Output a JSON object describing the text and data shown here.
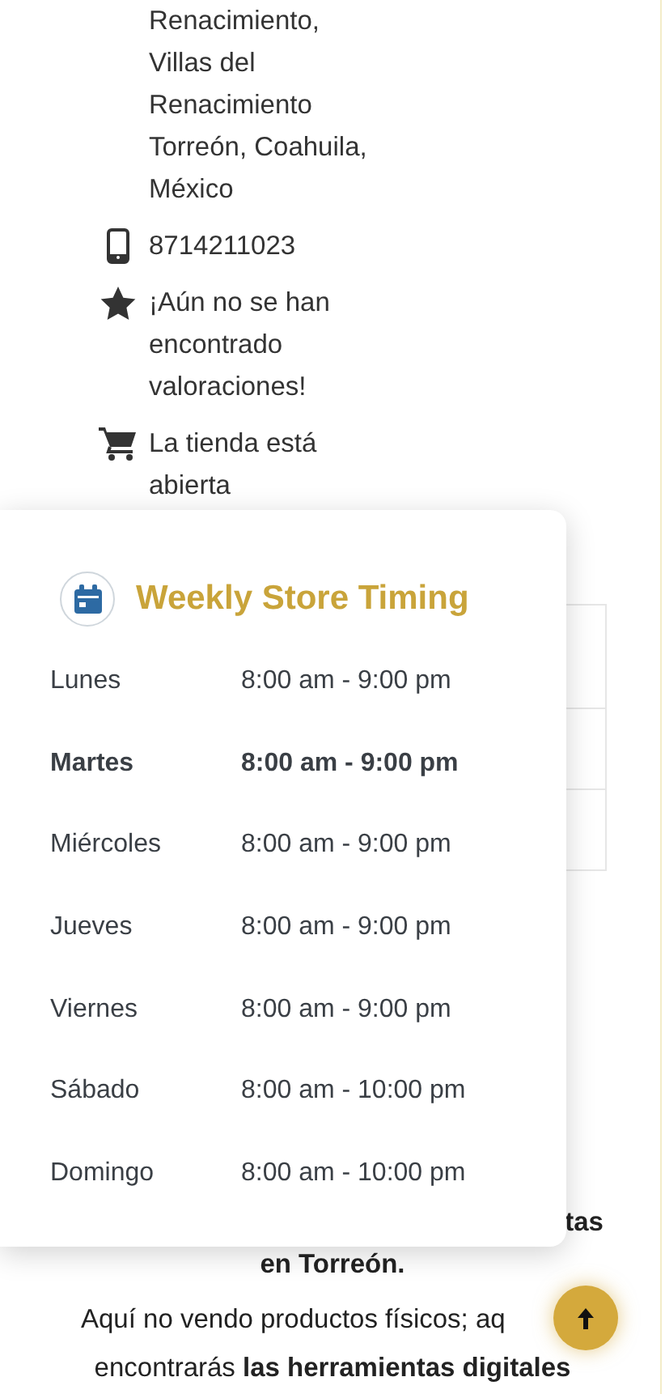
{
  "contact": {
    "address_lines": [
      "Renacimiento,",
      "Villas del",
      "Renacimiento",
      "Torreón, Coahuila,",
      "México"
    ],
    "phone": "8714211023",
    "rating": "¡Aún no se han encontrado valoraciones!",
    "store_status": "La tienda está abierta"
  },
  "hours_popup": {
    "title": "Weekly Store Timing",
    "days": [
      {
        "day": "Lunes",
        "hours": "8:00 am - 9:00 pm",
        "selected": false
      },
      {
        "day": "Martes",
        "hours": "8:00 am - 9:00 pm",
        "selected": true
      },
      {
        "day": "Miércoles",
        "hours": "8:00 am - 9:00 pm",
        "selected": false
      },
      {
        "day": "Jueves",
        "hours": "8:00 am - 9:00 pm",
        "selected": false
      },
      {
        "day": "Viernes",
        "hours": "8:00 am - 9:00 pm",
        "selected": false
      },
      {
        "day": "Sábado",
        "hours": "8:00 am - 10:00 pm",
        "selected": false
      },
      {
        "day": "Domingo",
        "hours": "8:00 am - 10:00 pm",
        "selected": false
      }
    ]
  },
  "intro": {
    "heading_end": "tas",
    "heading_line_2": "en Torreón.",
    "paragraph_line_1": "Aquí no vendo productos físicos; aq",
    "paragraph_line_2": "encontrarás **las herramientas digitales**"
  }
}
